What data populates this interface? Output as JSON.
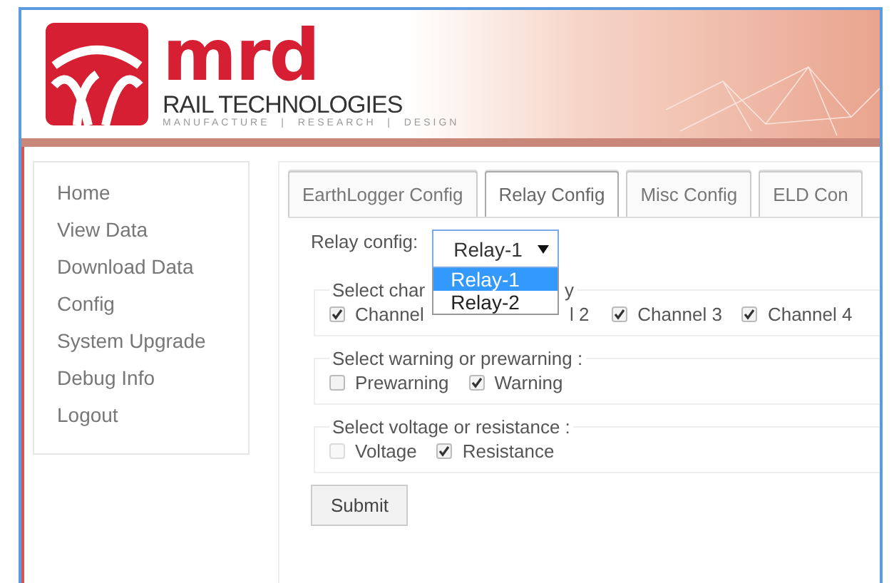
{
  "header": {
    "logo_word": "mrd",
    "tagline": "RAIL TECHNOLOGIES",
    "motto": "MANUFACTURE  |  RESEARCH  |  DESIGN"
  },
  "sidebar": {
    "items": [
      "Home",
      "View Data",
      "Download Data",
      "Config",
      "System Upgrade",
      "Debug Info",
      "Logout"
    ]
  },
  "tabs": [
    {
      "label": "EarthLogger Config",
      "selected": false
    },
    {
      "label": "Relay Config",
      "selected": true
    },
    {
      "label": "Misc Config",
      "selected": false
    },
    {
      "label": "ELD Con",
      "selected": false
    }
  ],
  "relay_select": {
    "label": "Relay config:",
    "value": "Relay-1",
    "options": [
      {
        "label": "Relay-1",
        "selected": true
      },
      {
        "label": "Relay-2",
        "selected": false
      }
    ]
  },
  "groups": [
    {
      "legend": [
        "Select char",
        "y"
      ],
      "options": [
        {
          "kind": "checkbox",
          "label": "Channel",
          "checked": true
        },
        {
          "kind": "fragment",
          "label": "l 2"
        },
        {
          "kind": "checkbox",
          "label": "Channel 3",
          "checked": true
        },
        {
          "kind": "checkbox",
          "label": "Channel 4",
          "checked": true
        }
      ]
    },
    {
      "legend": [
        "Select warning or prewarning :"
      ],
      "options": [
        {
          "kind": "checkbox",
          "label": "Prewarning",
          "checked": false
        },
        {
          "kind": "checkbox",
          "label": "Warning",
          "checked": true
        }
      ]
    },
    {
      "legend": [
        "Select voltage or resistance :"
      ],
      "options": [
        {
          "kind": "checkbox",
          "label": "Voltage",
          "checked": false,
          "disabled": true
        },
        {
          "kind": "checkbox",
          "label": "Resistance",
          "checked": true
        }
      ]
    }
  ],
  "submit": "Submit"
}
